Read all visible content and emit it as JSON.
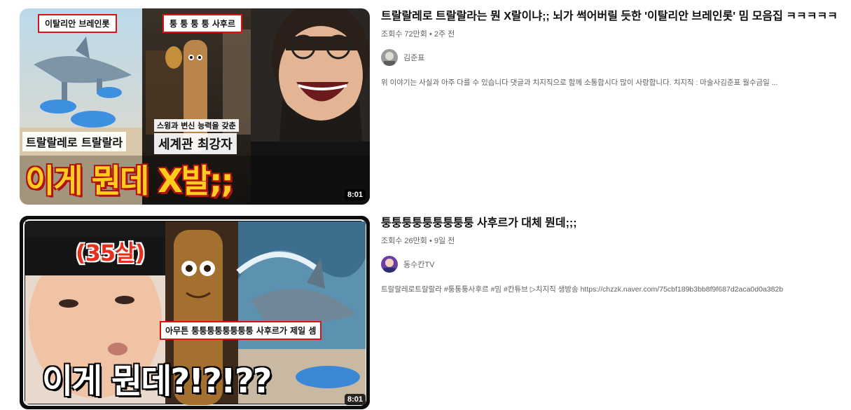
{
  "results": [
    {
      "title": "트랄랄레로 트랄랄라는 뭔 X랄이냐;; 뇌가 썩어버릴 듯한 '이탈리안 브레인롯' 밈 모음집 ㅋㅋㅋㅋㅋ",
      "views": "조회수 72만회",
      "age": "2주 전",
      "channel": "김준표",
      "description": "위 이야기는 사실과 아주 다를 수 있습니다 댓글과 치지직으로 함께 소통합시다 많이 사랑합니다. 치지직 : 마술사김준표 월수금일 ...",
      "duration": "8:01",
      "thumb": {
        "tag_left": "이탈리안 브레인롯",
        "tag_right": "퉁 퉁 퉁 퉁 사후르",
        "caption_left": "트랄랄레로 트랄랄라",
        "caption_small": "스윙과 변신 능력을 갖춘",
        "caption_right": "세계관 최강자",
        "headline": "이게 뭔데 X발;;"
      }
    },
    {
      "title": "퉁퉁퉁퉁퉁퉁퉁퉁퉁 사후르가 대체 뭔데;;;",
      "views": "조회수 26만회",
      "age": "9일 전",
      "channel": "동수칸TV",
      "description": "트랄랄레로트랄랄라 #퉁퉁퉁사후르 #밈 #칸튜브 ▷치지직 생방송 https://chzzk.naver.com/75cbf189b3bb8f9f687d2aca0d0a382b",
      "duration": "8:01",
      "thumb": {
        "age_tag": "(35살)",
        "banner": "아무튼 퉁퉁퉁퉁퉁퉁퉁퉁 사후르가 제일 셈",
        "headline": "이게 뭔데?!?!??"
      }
    }
  ],
  "meta_separator": "•"
}
